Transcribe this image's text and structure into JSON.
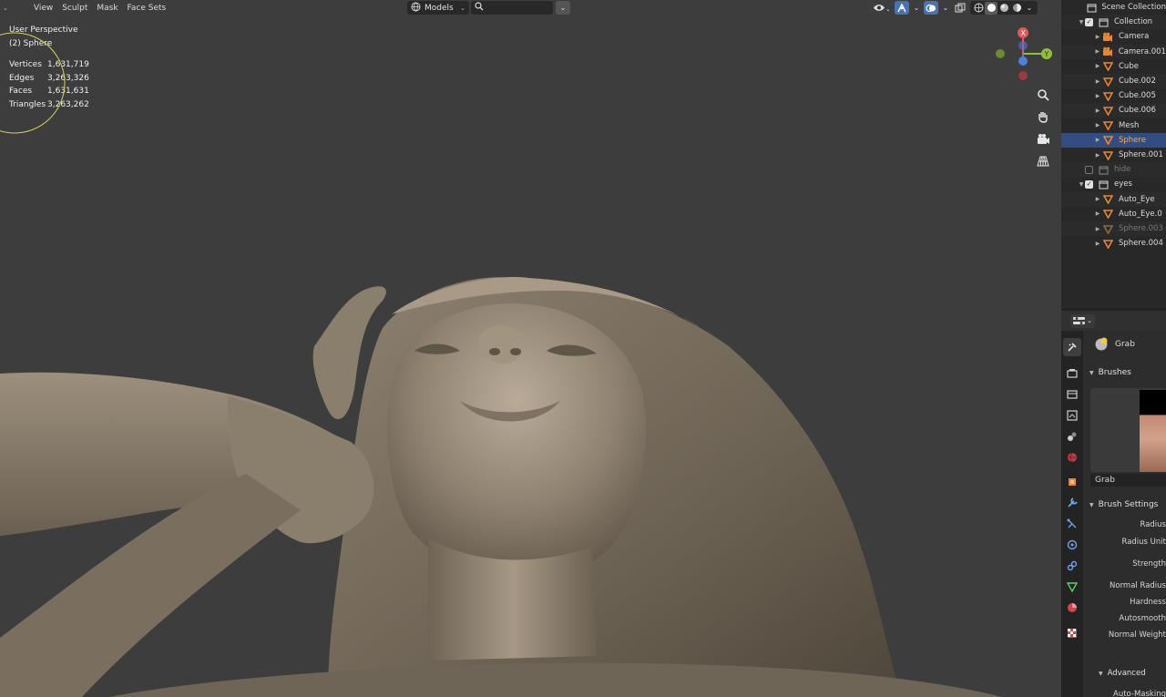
{
  "header": {
    "mode_caret": "⌄",
    "menus": [
      "View",
      "Sculpt",
      "Mask",
      "Face Sets"
    ],
    "models_dropdown": "Models",
    "search_placeholder": ""
  },
  "overlay": {
    "perspective": "User Perspective",
    "object": "(2) Sphere",
    "stats": [
      {
        "label": "Vertices",
        "value": "1,631,719"
      },
      {
        "label": "Edges",
        "value": "3,263,326"
      },
      {
        "label": "Faces",
        "value": "1,631,631"
      },
      {
        "label": "Triangles",
        "value": "3,263,262"
      }
    ]
  },
  "gizmo": {
    "x": "X",
    "y": "Y"
  },
  "outliner": {
    "items": [
      {
        "label": "Scene Collection",
        "type": "scene"
      },
      {
        "label": "Collection",
        "type": "collection"
      },
      {
        "label": "Camera",
        "type": "camera"
      },
      {
        "label": "Camera.001",
        "type": "camera"
      },
      {
        "label": "Cube",
        "type": "mesh"
      },
      {
        "label": "Cube.002",
        "type": "mesh"
      },
      {
        "label": "Cube.005",
        "type": "mesh"
      },
      {
        "label": "Cube.006",
        "type": "mesh"
      },
      {
        "label": "Mesh",
        "type": "mesh"
      },
      {
        "label": "Sphere",
        "type": "mesh",
        "selected": true
      },
      {
        "label": "Sphere.001",
        "type": "mesh"
      },
      {
        "label": "hide",
        "type": "collection",
        "dim": true
      },
      {
        "label": "eyes",
        "type": "collection"
      },
      {
        "label": "Auto_Eye",
        "type": "mesh"
      },
      {
        "label": "Auto_Eye.0",
        "type": "mesh"
      },
      {
        "label": "Sphere.003",
        "type": "mesh",
        "dim": true
      },
      {
        "label": "Sphere.004",
        "type": "mesh"
      }
    ]
  },
  "properties": {
    "brush_name": "Grab",
    "brushes_panel": "Brushes",
    "brush_field": "Grab",
    "brush_settings_panel": "Brush Settings",
    "settings": [
      "Radius",
      "Radius Unit",
      "Strength",
      "Normal Radius",
      "Hardness",
      "Autosmooth",
      "Normal Weight"
    ],
    "advanced_panel": "Advanced",
    "auto_masking": "Auto-Masking"
  },
  "colors": {
    "accent_selected": "#334d80",
    "active_text": "#ffaf29",
    "viewport_bg": "#3d3d3d"
  }
}
